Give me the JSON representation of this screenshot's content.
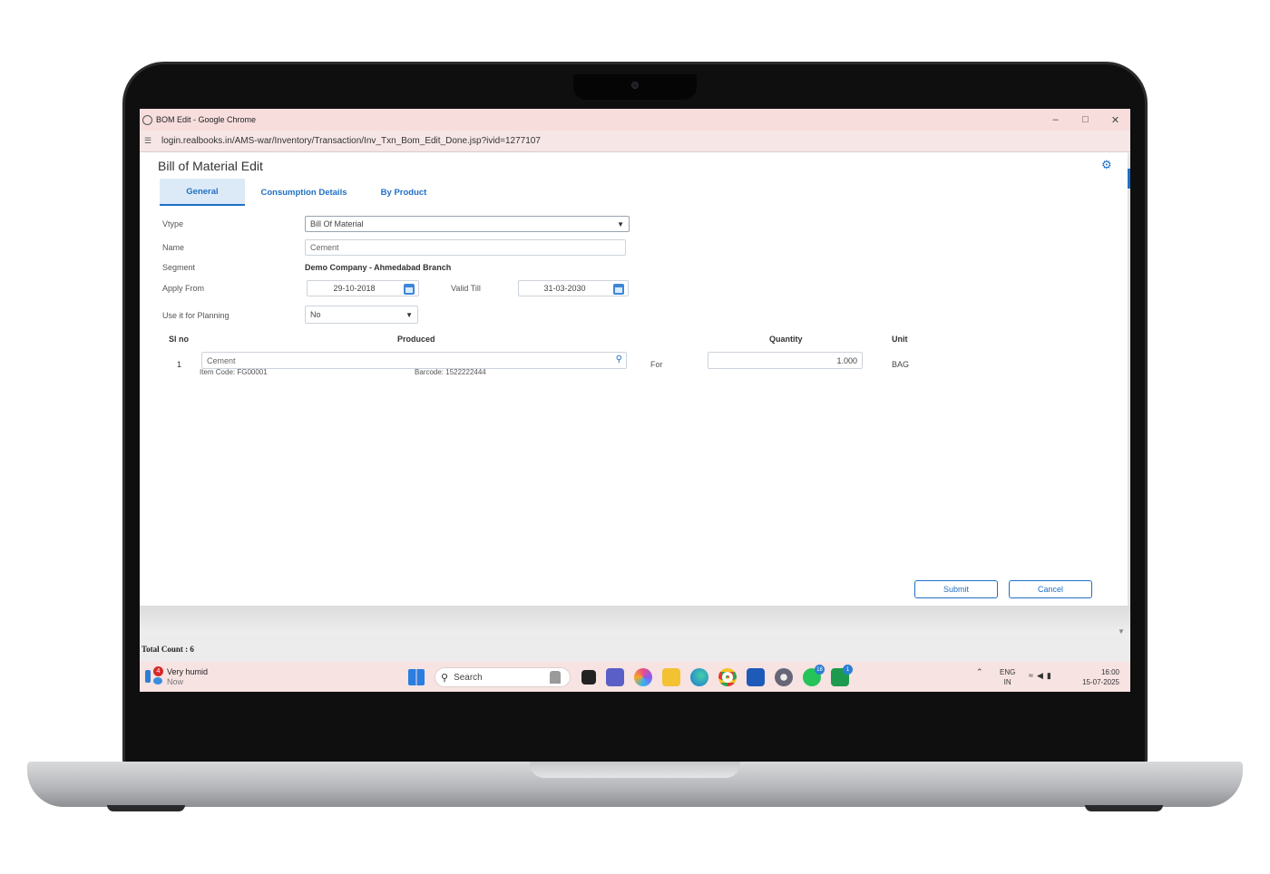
{
  "window": {
    "title": "BOM Edit - Google Chrome",
    "url": "login.realbooks.in/AMS-war/Inventory/Transaction/Inv_Txn_Bom_Edit_Done.jsp?ivid=1277107"
  },
  "page": {
    "title": "Bill of Material Edit",
    "tabs": [
      "General",
      "Consumption Details",
      "By Product"
    ]
  },
  "form": {
    "vtype_label": "Vtype",
    "vtype_value": "Bill Of Material",
    "name_label": "Name",
    "name_value": "Cement",
    "segment_label": "Segment",
    "segment_value": "Demo Company - Ahmedabad Branch",
    "apply_from_label": "Apply From",
    "apply_from_value": "29-10-2018",
    "valid_till_label": "Valid Till",
    "valid_till_value": "31-03-2030",
    "planning_label": "Use it for Planning",
    "planning_value": "No"
  },
  "grid": {
    "headers": {
      "sl": "Sl no",
      "produced": "Produced",
      "quantity": "Quantity",
      "unit": "Unit"
    },
    "row": {
      "sl": "1",
      "item": "Cement",
      "item_code": "Item Code: FG00001",
      "barcode": "Barcode: 1522222444",
      "for_label": "For",
      "quantity": "1.000",
      "unit": "BAG"
    }
  },
  "actions": {
    "submit": "Submit",
    "cancel": "Cancel"
  },
  "footer": {
    "total": "Total Count : 6"
  },
  "taskbar": {
    "weather_badge": "4",
    "weather_text": "Very humid",
    "weather_sub": "Now",
    "search": "Search",
    "whatsapp_count": "18",
    "other_count": "1",
    "lang_top": "ENG",
    "lang_bottom": "IN",
    "time": "16:00",
    "date": "15-07-2025"
  },
  "colors": {
    "accent": "#1f6fc5",
    "titlebar": "#f7dedd",
    "taskbar": "#f6e3e2"
  }
}
